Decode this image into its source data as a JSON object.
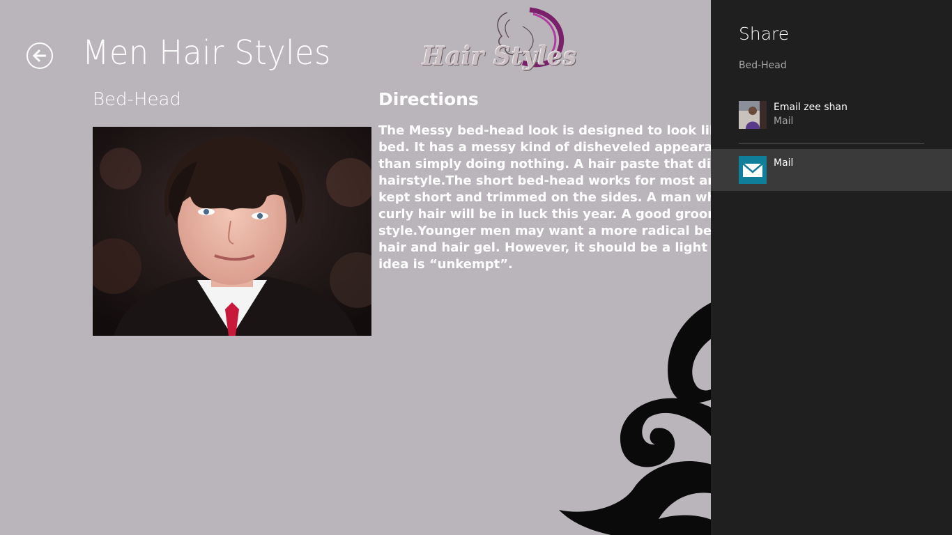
{
  "header": {
    "title": "Men Hair Styles",
    "back_icon": "back-arrow-icon",
    "logo_text": "Hair Styles"
  },
  "item": {
    "title": "Bed-Head",
    "photo": "man-portrait-photo"
  },
  "directions": {
    "heading": "Directions",
    "lines": [
      "The Messy bed-head look is designed to look like so",
      "bed. It has a messy kind of disheveled appearance. H",
      "than simply doing nothing. A hair paste that dissolve",
      "hairstyle.The short bed-head works for most any ma",
      "kept short and trimmed on the sides. A man who wa",
      "curly hair will be in luck this year. A good grooming c",
      "style.Younger men may want a more radical bed-hea",
      "hair and hair gel. However, it should be a light gel th",
      "idea is “unkempt”."
    ]
  },
  "share": {
    "title": "Share",
    "subtitle": "Bed-Head",
    "recent": {
      "label": "Email zee shan",
      "sublabel": "Mail",
      "icon": "contact-avatar-photo"
    },
    "apps": [
      {
        "label": "Mail",
        "icon": "mail-envelope-icon",
        "color": "#0e7e9b"
      }
    ]
  },
  "colors": {
    "background": "#bab5ba",
    "pane": "#1f1f1f",
    "selected_item": "#3a3a3a",
    "mail_tile": "#0e7e9b"
  }
}
